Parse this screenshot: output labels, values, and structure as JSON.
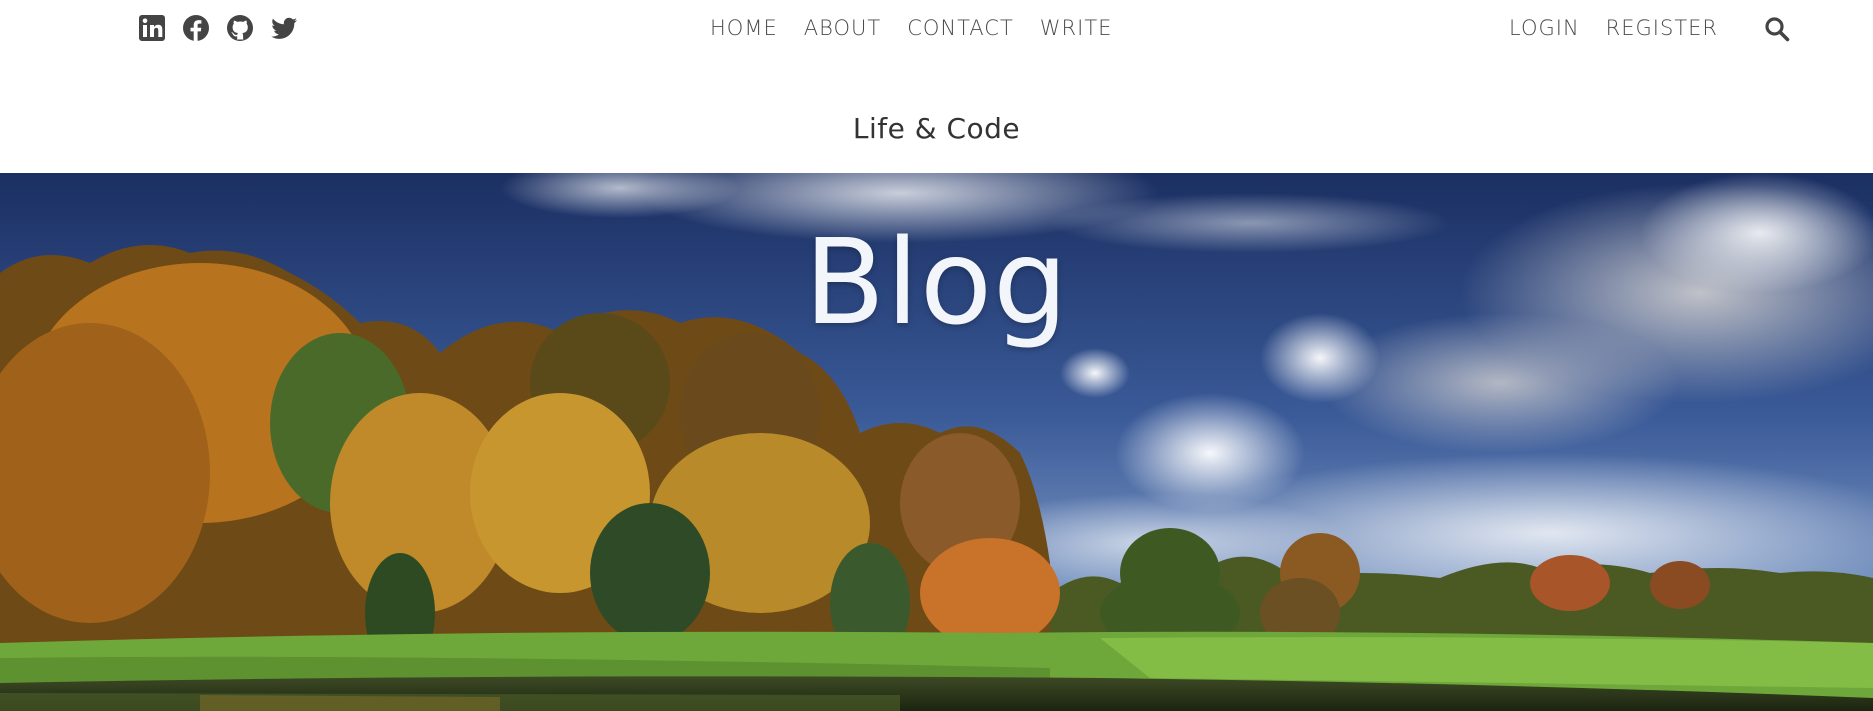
{
  "socials": [
    {
      "icon": "linkedin-icon"
    },
    {
      "icon": "facebook-icon"
    },
    {
      "icon": "github-icon"
    },
    {
      "icon": "twitter-icon"
    }
  ],
  "nav": {
    "home": "HOME",
    "about": "ABOUT",
    "contact": "CONTACT",
    "write": "WRITE",
    "login": "LOGIN",
    "register": "REGISTER",
    "search_icon": "search-icon"
  },
  "site_title": "Life & Code",
  "hero": {
    "title": "Blog"
  },
  "colors": {
    "text": "#4a4a4a",
    "sky_top": "#1d3266",
    "sky_bottom": "#6c86b8",
    "grass": "#6fa83a",
    "hero_title": "#f2f6fb"
  }
}
